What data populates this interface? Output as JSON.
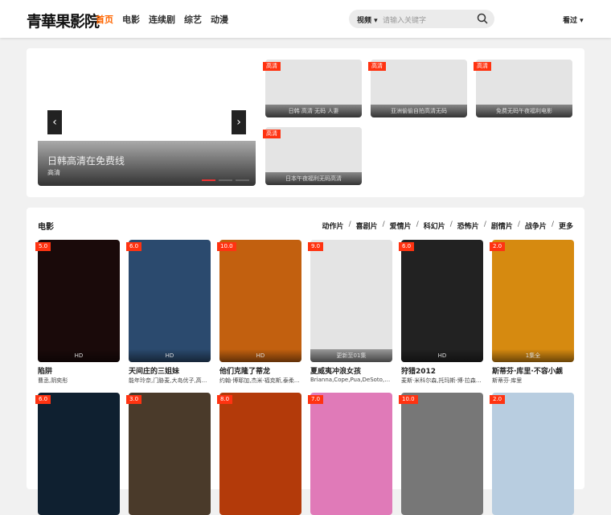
{
  "header": {
    "logo": "青華果影院",
    "nav": [
      "首页",
      "电影",
      "连续剧",
      "综艺",
      "动漫"
    ],
    "search_type": "视频",
    "search_placeholder": "请输入关键字",
    "history": "看过"
  },
  "banner": {
    "main": {
      "title": "日韩高清在免费线",
      "sub": "高清"
    },
    "thumbs": [
      {
        "tag": "高清",
        "title": "日韩 高清 无码 人妻"
      },
      {
        "tag": "高清",
        "title": "亚洲偷偷自拍高清无码"
      },
      {
        "tag": "高清",
        "title": "免费无码午夜福利电影"
      },
      {
        "tag": "高清",
        "title": "日本午夜福利无码高清"
      }
    ]
  },
  "movies": {
    "title": "电影",
    "categories": [
      "动作片",
      "喜剧片",
      "爱情片",
      "科幻片",
      "恐怖片",
      "剧情片",
      "战争片",
      "更多"
    ],
    "items": [
      {
        "score": "5.0",
        "title": "陷阱",
        "sub": "曹丞,阴奕彤",
        "overlay": "HD",
        "color": "#1a0a0a"
      },
      {
        "score": "6.0",
        "title": "天间庄的三姐妹",
        "sub": "能年玲奈,门胁麦,大岛优子,高...",
        "overlay": "HD",
        "color": "#2b4a6e"
      },
      {
        "score": "10.0",
        "title": "他们克隆了蒂龙",
        "sub": "约翰·博耶加,杰米·福克斯,泰柔...",
        "overlay": "HD",
        "color": "#c2600f"
      },
      {
        "score": "9.0",
        "title": "夏威夷冲浪女孩",
        "sub": "Brianna,Cope,Pua,DeSoto,M...",
        "overlay": "更新至01集",
        "color": "#e4e4e4"
      },
      {
        "score": "6.0",
        "title": "狩猎2012",
        "sub": "麦斯·米科尔森,托玛斯·博·拉森...",
        "overlay": "HD",
        "color": "#222"
      },
      {
        "score": "2.0",
        "title": "斯蒂芬·库里·不容小觑",
        "sub": "斯蒂芬·库里",
        "overlay": "1集全",
        "color": "#d68a10"
      },
      {
        "score": "6.0",
        "title": "",
        "sub": "",
        "overlay": "",
        "color": "#0f2030"
      },
      {
        "score": "3.0",
        "title": "",
        "sub": "",
        "overlay": "",
        "color": "#4a3a2a"
      },
      {
        "score": "8.0",
        "title": "",
        "sub": "",
        "overlay": "",
        "color": "#b33a0a"
      },
      {
        "score": "7.0",
        "title": "",
        "sub": "",
        "overlay": "",
        "color": "#e07ab8"
      },
      {
        "score": "10.0",
        "title": "",
        "sub": "",
        "overlay": "",
        "color": "#777"
      },
      {
        "score": "2.0",
        "title": "",
        "sub": "",
        "overlay": "",
        "color": "#b8cde0"
      }
    ]
  }
}
